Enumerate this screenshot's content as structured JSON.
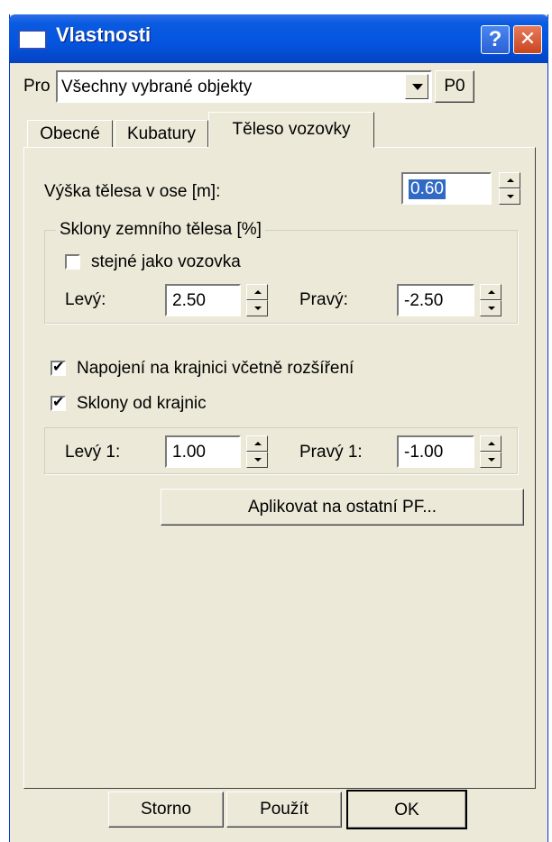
{
  "window": {
    "title": "Vlastnosti",
    "help_glyph": "?",
    "close_glyph": "✕"
  },
  "for_row": {
    "label": "Pro",
    "selected": "Všechny vybrané objekty",
    "p0_button": "P0"
  },
  "tabs": [
    {
      "label": "Obecné",
      "active": false
    },
    {
      "label": "Kubatury",
      "active": false
    },
    {
      "label": "Těleso vozovky",
      "active": true
    }
  ],
  "body": {
    "height_label": "Výška tělesa v ose [m]:",
    "height_value": "0.60",
    "slopes_group_title": "Sklony zemního tělesa [%]",
    "same_as_road_label": "stejné jako vozovka",
    "same_as_road_checked": false,
    "left_label": "Levý:",
    "left_value": "2.50",
    "right_label": "Pravý:",
    "right_value": "-2.50",
    "connect_label": "Napojení na krajnici včetně rozšíření",
    "connect_checked": true,
    "shoulder_slopes_label": "Sklony od krajnic",
    "shoulder_slopes_checked": true,
    "left1_label": "Levý 1:",
    "left1_value": "1.00",
    "right1_label": "Pravý 1:",
    "right1_value": "-1.00",
    "apply_button": "Aplikovat na ostatní PF..."
  },
  "footer": {
    "cancel": "Storno",
    "apply": "Použít",
    "ok": "OK"
  },
  "colors": {
    "titlebar": "#0454df",
    "dialog_bg": "#ece9d8",
    "selection": "#316ac5",
    "close_button": "#c9461f"
  }
}
